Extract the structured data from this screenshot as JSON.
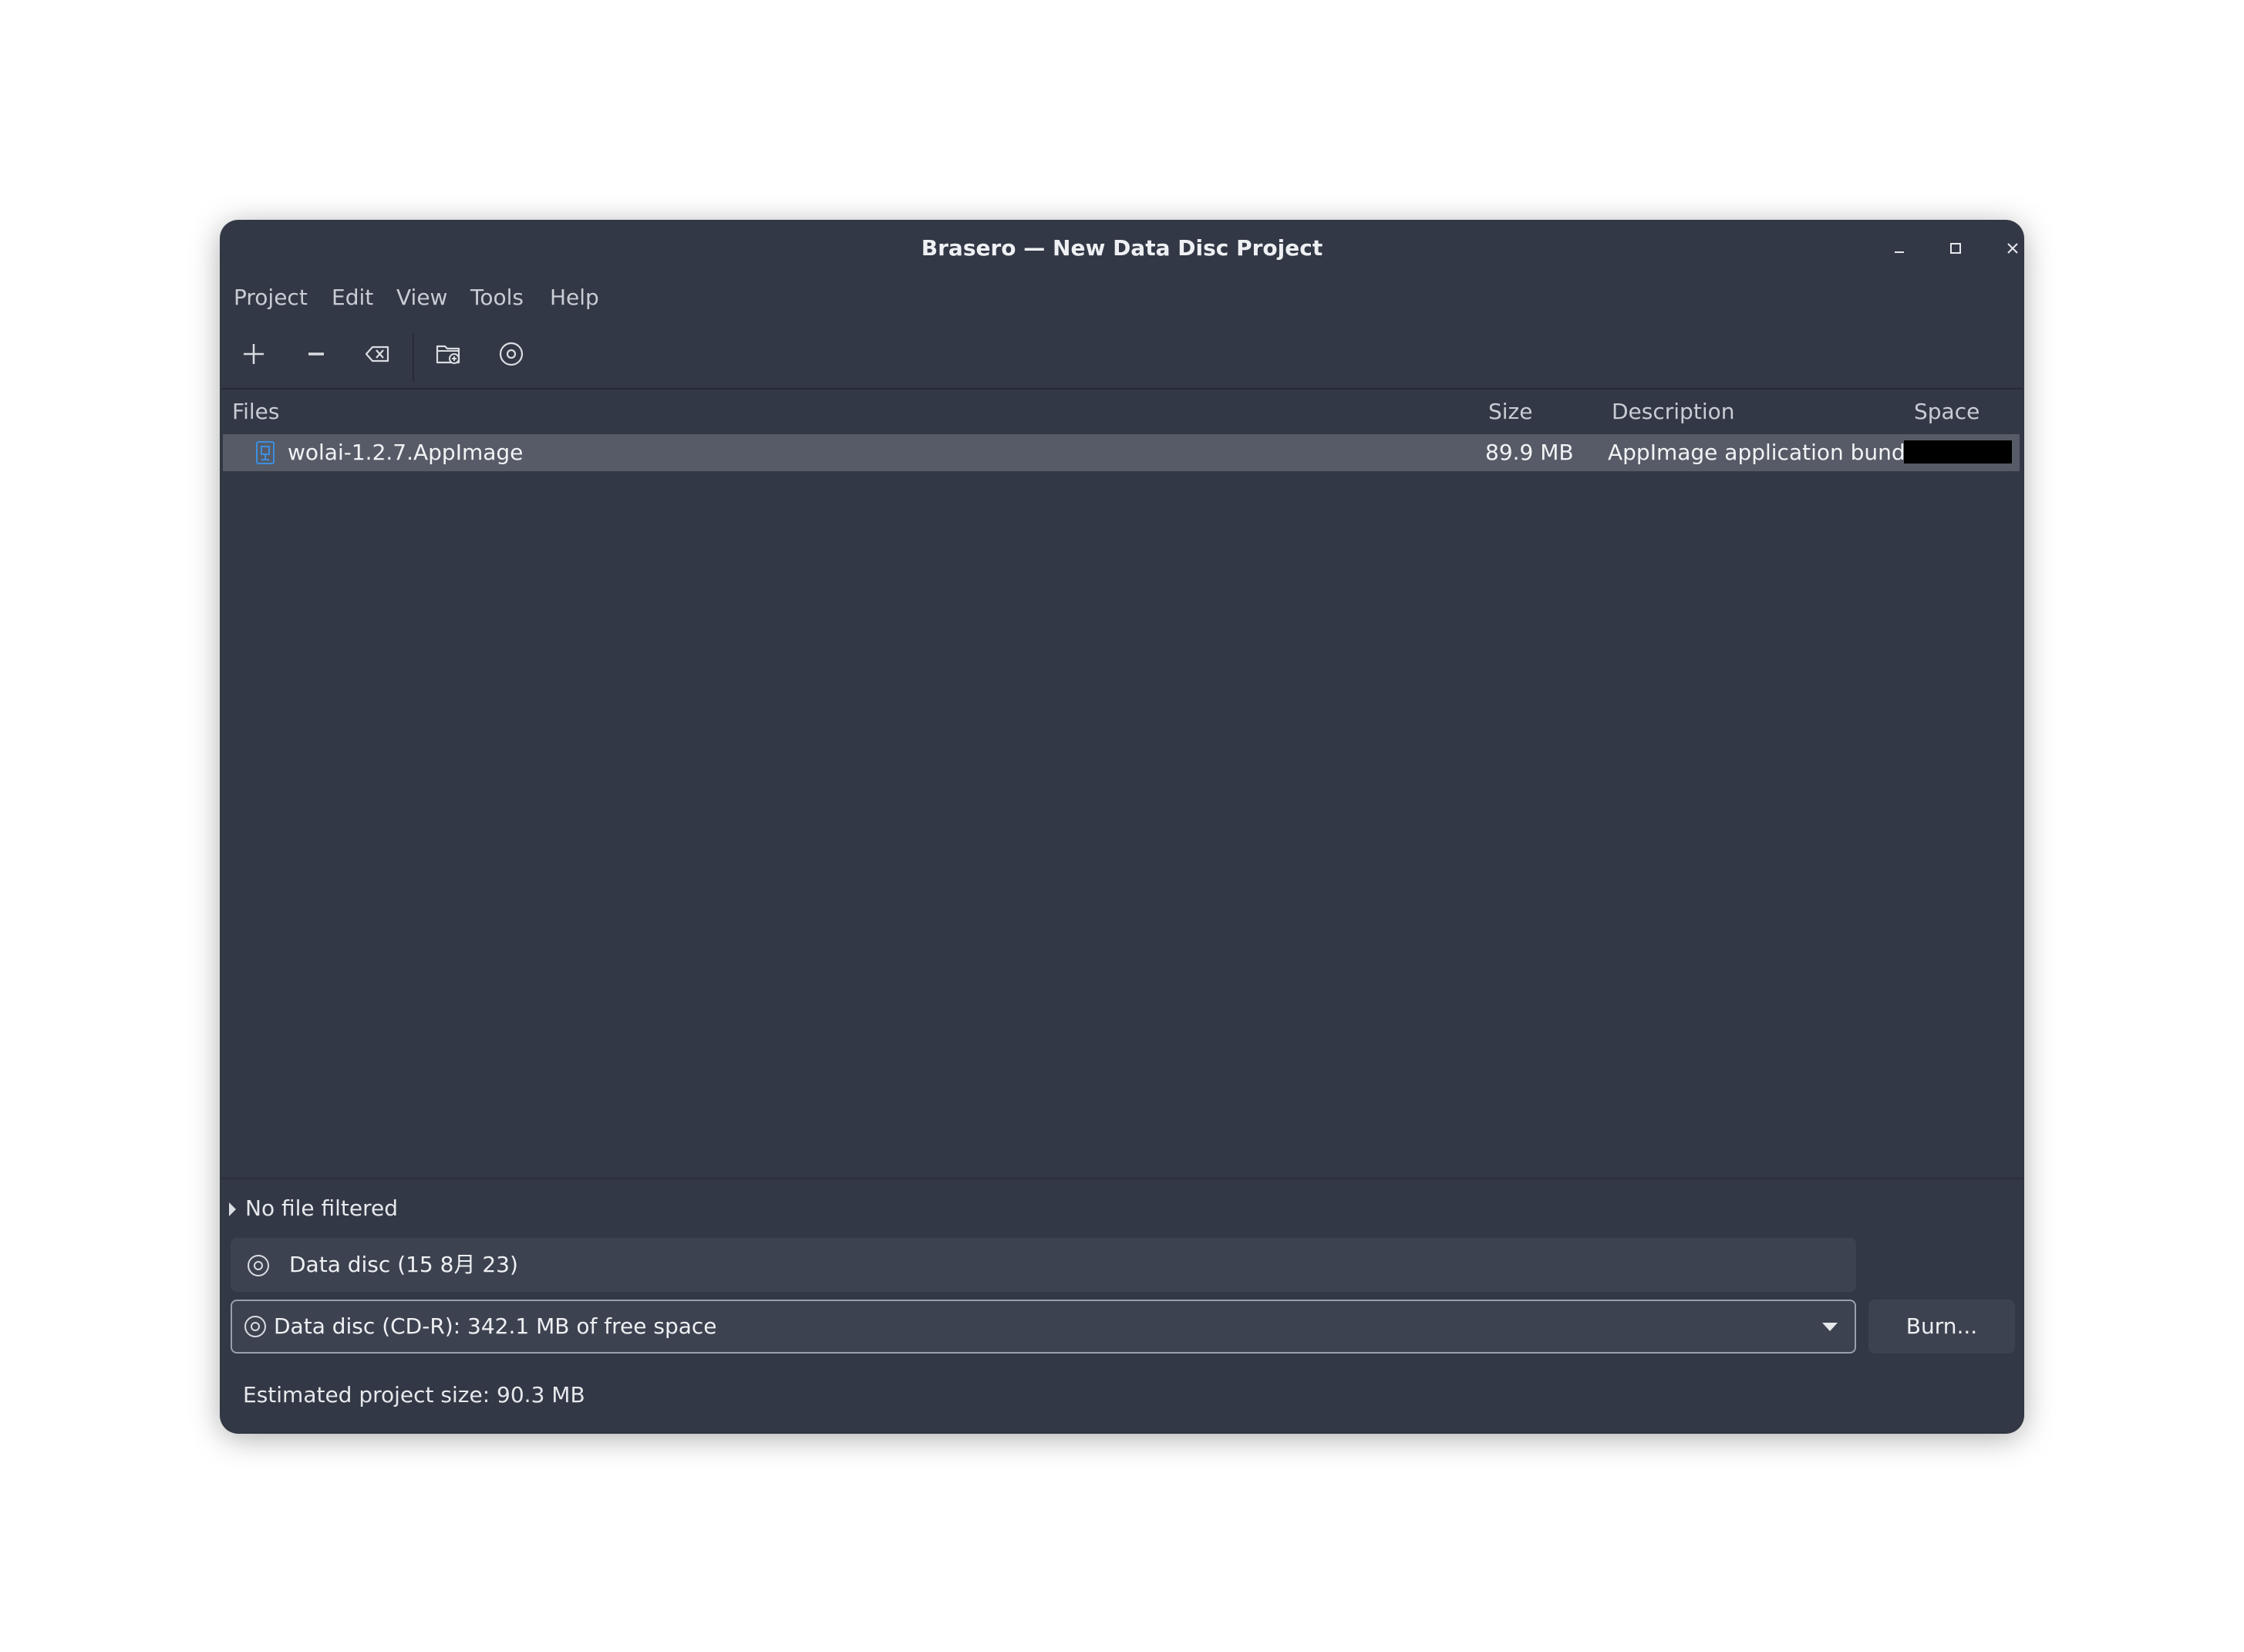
{
  "window": {
    "title": "Brasero — New Data Disc Project"
  },
  "menubar": {
    "items": [
      "Project",
      "Edit",
      "View",
      "Tools",
      "Help"
    ]
  },
  "toolbar": {
    "buttons": [
      {
        "icon": "plus-icon"
      },
      {
        "icon": "minus-icon"
      },
      {
        "icon": "clear-icon"
      },
      {
        "icon": "new-folder-icon"
      },
      {
        "icon": "disc-icon"
      }
    ]
  },
  "filelist": {
    "columns": [
      "Files",
      "Size",
      "Description",
      "Space"
    ],
    "rows": [
      {
        "name": "wolai-1.2.7.AppImage",
        "size": "89.9 MB",
        "description": "AppImage application bundle"
      }
    ]
  },
  "filter": {
    "label": "No file filtered"
  },
  "project": {
    "name": "Data disc (15 8月 23)"
  },
  "disc": {
    "selected": "Data disc (CD-R): 342.1 MB of free space"
  },
  "actions": {
    "burn_label": "Burn..."
  },
  "status": {
    "text": "Estimated project size: 90.3 MB"
  },
  "colors": {
    "window_bg": "#323845",
    "selected_row": "#565b67",
    "accent_file_icon": "#3d8ee0"
  }
}
